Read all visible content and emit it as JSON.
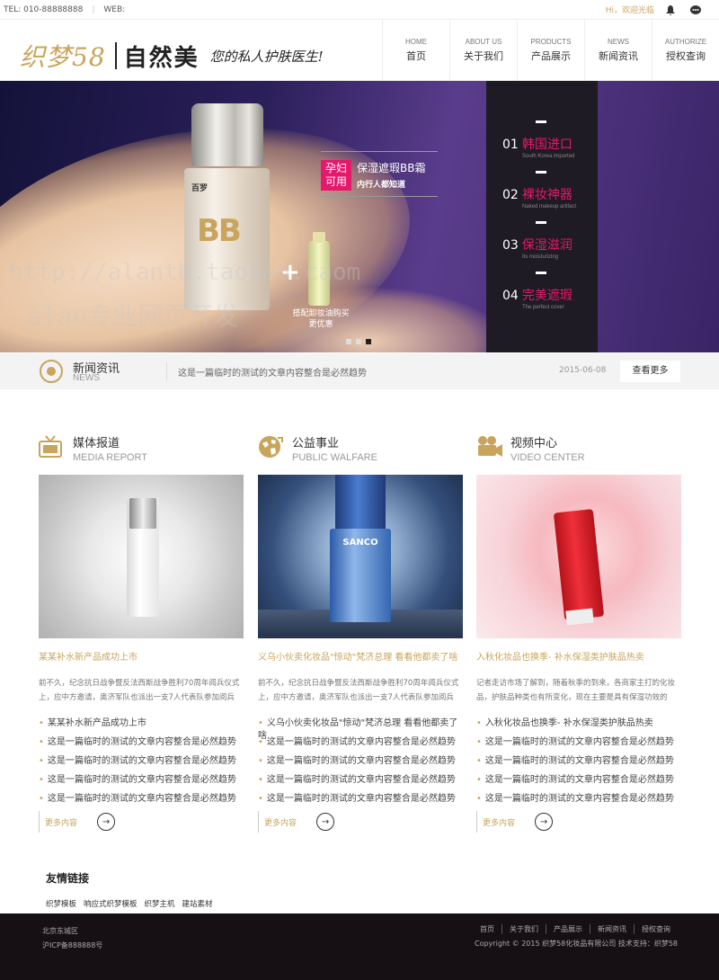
{
  "topbar": {
    "tel": "TEL: 010-88888888",
    "web": "WEB:",
    "welcome": "Hi，欢迎光临"
  },
  "logo": {
    "brand": "织梦58",
    "name": "自然美",
    "slogan": "您的私人护肤医生!"
  },
  "nav": [
    {
      "en": "HOME",
      "zh": "首页"
    },
    {
      "en": "ABOUT US",
      "zh": "关于我们"
    },
    {
      "en": "PRODUCTS",
      "zh": "产品展示"
    },
    {
      "en": "NEWS",
      "zh": "新闻资讯"
    },
    {
      "en": "AUTHORIZE",
      "zh": "授权查询"
    }
  ],
  "banner": {
    "product_label": "百罗",
    "promo_badge": "孕妇可用",
    "promo_title": "保湿遮瑕BB霜",
    "promo_sub": "内行人都知道",
    "cleanser_text": "搭配卸妆油购买更优惠",
    "features": [
      {
        "num": "01",
        "title": "韩国进口",
        "sub": "South Korea imported"
      },
      {
        "num": "02",
        "title": "裸妆神器",
        "sub": "Naked makeup artifact"
      },
      {
        "num": "03",
        "title": "保湿滋润",
        "sub": "Its moisturizing"
      },
      {
        "num": "04",
        "title": "完美遮瑕",
        "sub": "The perfect cover"
      }
    ],
    "watermark1": "http://alantb.taobao.caom",
    "watermark2": "alan专业网页开发"
  },
  "newsbar": {
    "title": "新闻资讯",
    "en": "NEWS",
    "text": "这是一篇临时的测试的文章内容整合是必然趋势",
    "date": "2015-06-08",
    "btn": "查看更多"
  },
  "columns": [
    {
      "title": "媒体报道",
      "en": "MEDIA REPORT",
      "headline": "某某补水新产品成功上市",
      "summary": "前不久，纪念抗日战争暨反法西斯战争胜利70周年阅兵仪式上，应中方邀请，奥济军队也派出一支7人代表队参加阅兵",
      "items": [
        "某某补水新产品成功上市",
        "这是一篇临时的测试的文章内容整合是必然趋势",
        "这是一篇临时的测试的文章内容整合是必然趋势",
        "这是一篇临时的测试的文章内容整合是必然趋势",
        "这是一篇临时的测试的文章内容整合是必然趋势"
      ],
      "more": "更多内容"
    },
    {
      "title": "公益事业",
      "en": "PUBLIC WALFARE",
      "headline": "义乌小伙卖化妆品\"惊动\"梵济总理 看看他都卖了啥",
      "summary": "前不久，纪念抗日战争暨反法西斯战争胜利70周年阅兵仪式上，应中方邀请，奥济军队也派出一支7人代表队参加阅兵",
      "items": [
        "义乌小伙卖化妆品\"惊动\"梵济总理 看看他都卖了啥",
        "这是一篇临时的测试的文章内容整合是必然趋势",
        "这是一篇临时的测试的文章内容整合是必然趋势",
        "这是一篇临时的测试的文章内容整合是必然趋势",
        "这是一篇临时的测试的文章内容整合是必然趋势"
      ],
      "more": "更多内容",
      "product_brand": "SANCO"
    },
    {
      "title": "视频中心",
      "en": "VIDEO CENTER",
      "headline": "入秋化妆品也换季- 补水保湿类护肤品热卖",
      "summary": "记者走访市场了解到，随着秋季的到来，各商家主打的化妆品，护肤品种类也有所变化，现在主要是具有保湿功效的",
      "items": [
        "入秋化妆品也换季- 补水保湿类护肤品热卖",
        "这是一篇临时的测试的文章内容整合是必然趋势",
        "这是一篇临时的测试的文章内容整合是必然趋势",
        "这是一篇临时的测试的文章内容整合是必然趋势",
        "这是一篇临时的测试的文章内容整合是必然趋势"
      ],
      "more": "更多内容"
    }
  ],
  "links": {
    "title": "友情链接",
    "items": [
      "织梦模板",
      "响应式织梦模板",
      "织梦主机",
      "建站素材"
    ]
  },
  "footer": {
    "address": "北京东城区",
    "icp": "沪ICP备888888号",
    "nav": [
      "首页",
      "关于我们",
      "产品展示",
      "新闻资讯",
      "授权查询"
    ],
    "copyright": "Copyright © 2015 织梦58化妆品有限公司 技术支持：织梦58"
  },
  "colors": {
    "accent": "#c9a45c",
    "pink": "#e5196c",
    "dark": "#161014"
  }
}
